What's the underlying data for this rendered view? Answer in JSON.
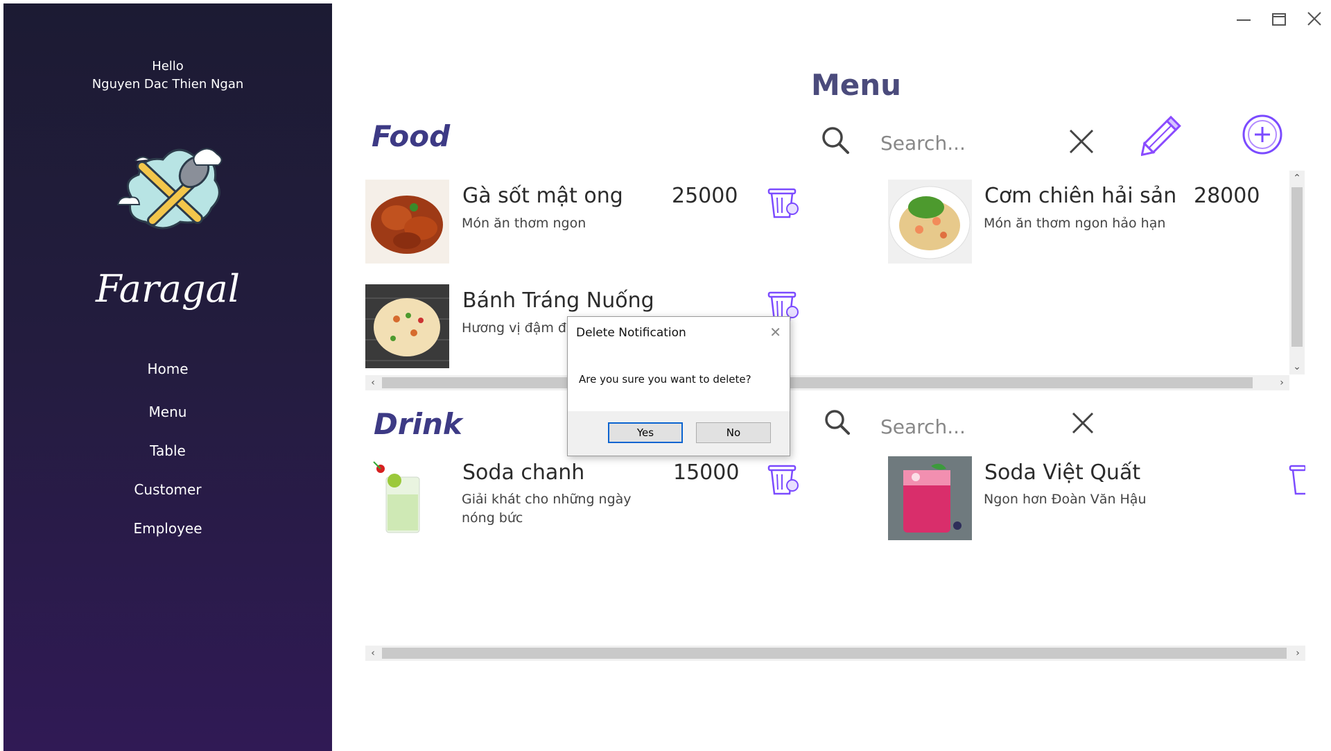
{
  "sidebar": {
    "greeting": "Hello",
    "user_name": "Nguyen Dac Thien Ngan",
    "brand": "Faragal",
    "nav": [
      "Home",
      "Menu",
      "Table",
      "Customer",
      "Employee"
    ]
  },
  "page_title": "Menu",
  "food": {
    "title": "Food",
    "search_placeholder": "Search...",
    "items": [
      {
        "name": "Gà sốt mật ong",
        "desc": "Món ăn thơm ngon",
        "price": "25000"
      },
      {
        "name": "Cơm chiên hải sản",
        "desc": "Món ăn thơm ngon hảo hạn",
        "price": "28000"
      },
      {
        "name": "Bánh Tráng Nuống",
        "desc": "Hương vị đậm đ",
        "price": ""
      }
    ]
  },
  "drink": {
    "title": "Drink",
    "search_placeholder": "Search...",
    "items": [
      {
        "name": "Soda chanh",
        "desc": "Giải khát cho những ngày nóng bức",
        "price": "15000"
      },
      {
        "name": "Soda Việt Quất",
        "desc": "Ngon hơn Đoàn Văn Hậu",
        "price": ""
      }
    ]
  },
  "dialog": {
    "title": "Delete Notification",
    "message": "Are you sure you want to delete?",
    "yes": "Yes",
    "no": "No"
  },
  "colors": {
    "sidebar_top": "#1c1b33",
    "sidebar_bottom": "#301a55",
    "accent_purple": "#7b4bff",
    "title_color": "#3d3a85"
  }
}
